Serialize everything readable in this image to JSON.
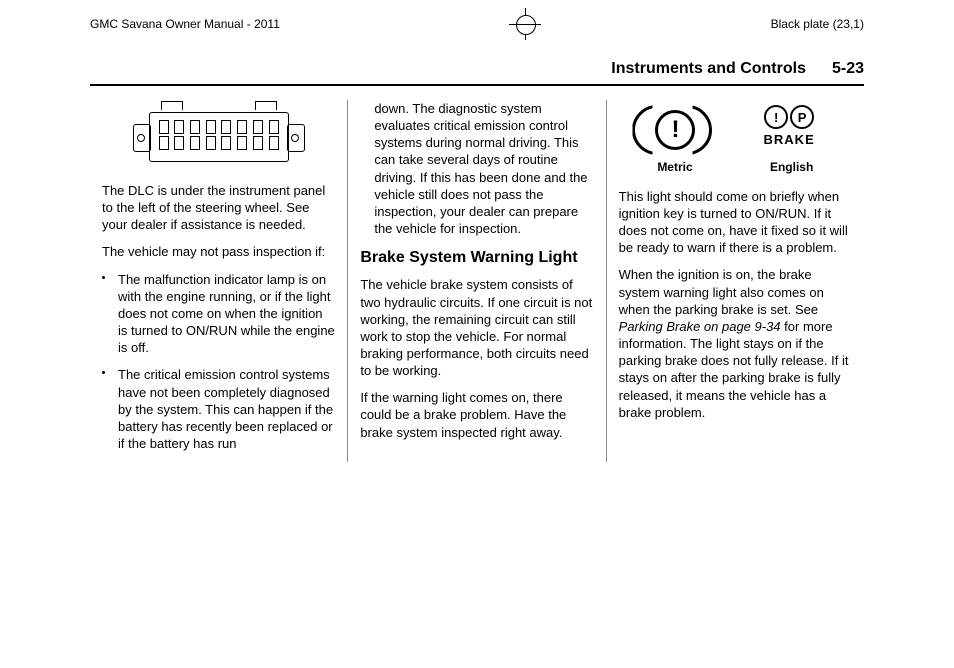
{
  "header": {
    "manual_title": "GMC Savana Owner Manual - 2011",
    "plate": "Black plate (23,1)"
  },
  "section": {
    "title": "Instruments and Controls",
    "page": "5-23"
  },
  "col1": {
    "p1": "The DLC is under the instrument panel to the left of the steering wheel. See your dealer if assistance is needed.",
    "p2": "The vehicle may not pass inspection if:",
    "li1": "The malfunction indicator lamp is on with the engine running, or if the light does not come on when the ignition is turned to ON/RUN while the engine is off.",
    "li2": "The critical emission control systems have not been completely diagnosed by the system. This can happen if the battery has recently been replaced or if the battery has run"
  },
  "col2": {
    "p1": "down. The diagnostic system evaluates critical emission control systems during normal driving. This can take several days of routine driving. If this has been done and the vehicle still does not pass the inspection, your dealer can prepare the vehicle for inspection.",
    "h2": "Brake System Warning Light",
    "p2": "The vehicle brake system consists of two hydraulic circuits. If one circuit is not working, the remaining circuit can still work to stop the vehicle. For normal braking performance, both circuits need to be working.",
    "p3": "If the warning light comes on, there could be a brake problem. Have the brake system inspected right away."
  },
  "col3": {
    "label_metric": "Metric",
    "label_english": "English",
    "brake_word": "BRAKE",
    "p1": "This light should come on briefly when ignition key is turned to ON/RUN. If it does not come on, have it fixed so it will be ready to warn if there is a problem.",
    "p2a": "When the ignition is on, the brake system warning light also comes on when the parking brake is set. See ",
    "p2i": "Parking Brake on page 9-34",
    "p2b": " for more information. The light stays on if the parking brake does not fully release. If it stays on after the parking brake is fully released, it means the vehicle has a brake problem."
  }
}
